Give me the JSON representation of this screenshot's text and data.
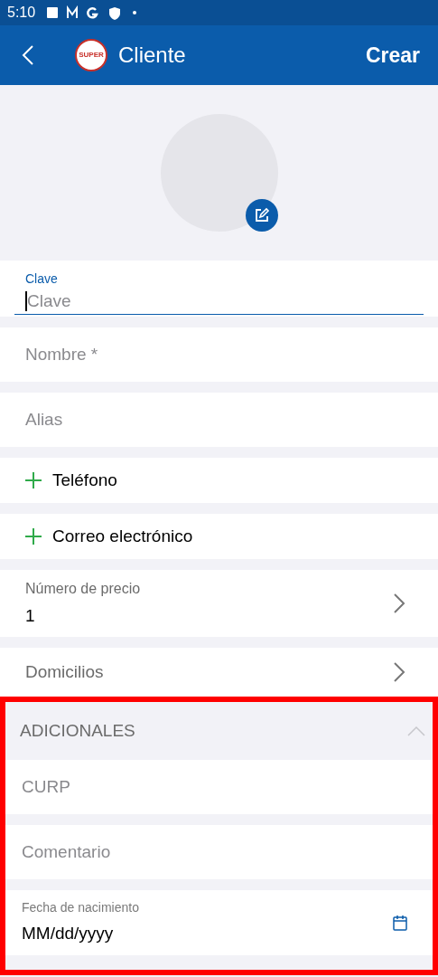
{
  "status_bar": {
    "time": "5:10"
  },
  "app_bar": {
    "title": "Cliente",
    "logo_text": "SUPER",
    "action": "Crear"
  },
  "clave": {
    "label": "Clave",
    "placeholder": "Clave",
    "focused": true
  },
  "fields": [
    {
      "kind": "input",
      "placeholder": "Nombre *"
    },
    {
      "kind": "input",
      "placeholder": "Alias"
    },
    {
      "kind": "add",
      "label": "Teléfono"
    },
    {
      "kind": "add",
      "label": "Correo electrónico"
    },
    {
      "kind": "select",
      "label": "Número de precio",
      "value": "1"
    },
    {
      "kind": "nav",
      "label": "Domicilios"
    }
  ],
  "additional": {
    "title": "ADICIONALES",
    "expanded": true,
    "highlighted": true,
    "fields": [
      {
        "kind": "input",
        "placeholder": "CURP"
      },
      {
        "kind": "input",
        "placeholder": "Comentario"
      },
      {
        "kind": "date",
        "label": "Fecha de nacimiento",
        "value": "MM/dd/yyyy"
      }
    ]
  }
}
